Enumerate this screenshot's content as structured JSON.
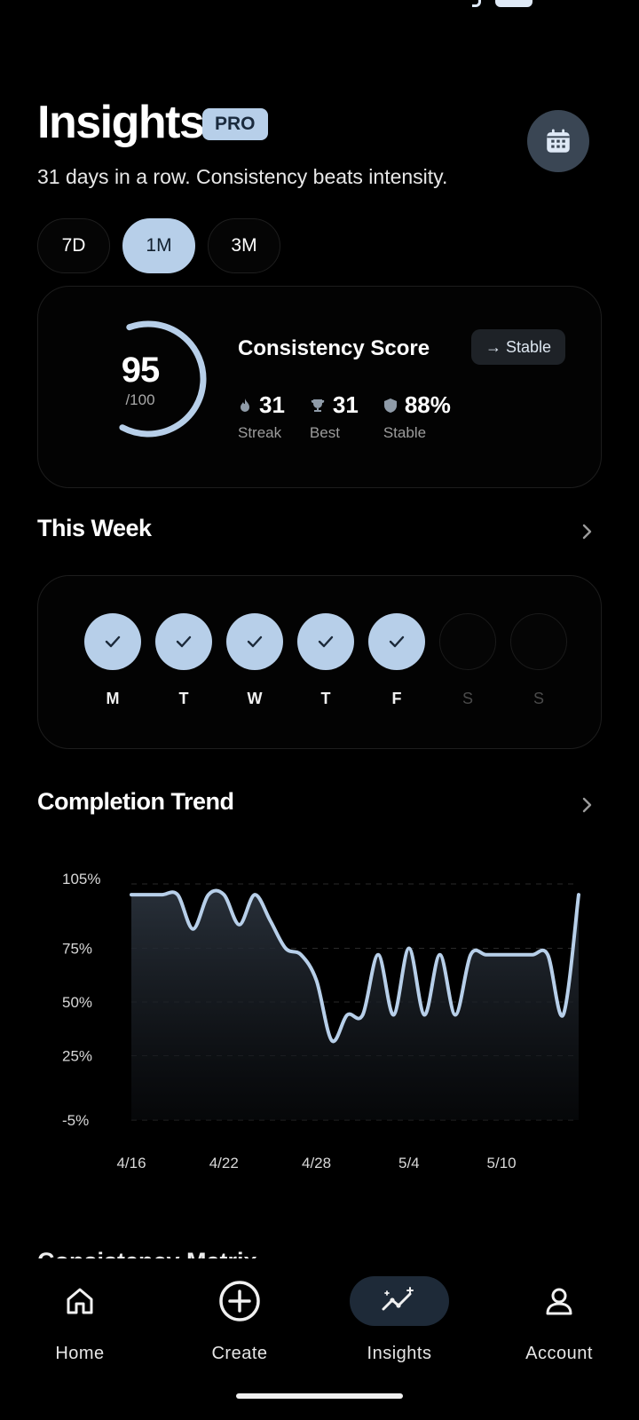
{
  "header": {
    "title": "Insights",
    "badge": "PRO",
    "subtitle": "31 days in a row. Consistency beats intensity.",
    "calendar_icon": "calendar-icon"
  },
  "range_tabs": [
    {
      "label": "7D",
      "active": false
    },
    {
      "label": "1M",
      "active": true
    },
    {
      "label": "3M",
      "active": false
    }
  ],
  "score": {
    "value": "95",
    "max": "/100",
    "fraction": 0.95,
    "title": "Consistency Score",
    "status": "→ Stable",
    "stats": [
      {
        "icon": "flame-icon",
        "value": "31",
        "label": "Streak"
      },
      {
        "icon": "trophy-icon",
        "value": "31",
        "label": "Best"
      },
      {
        "icon": "shield-icon",
        "value": "88%",
        "label": "Stable"
      }
    ]
  },
  "week": {
    "title": "This Week",
    "days": [
      {
        "label": "M",
        "done": true
      },
      {
        "label": "T",
        "done": true
      },
      {
        "label": "W",
        "done": true
      },
      {
        "label": "T",
        "done": true
      },
      {
        "label": "F",
        "done": true
      },
      {
        "label": "S",
        "done": false
      },
      {
        "label": "S",
        "done": false
      }
    ]
  },
  "trend": {
    "title": "Completion Trend"
  },
  "chart_data": {
    "type": "area",
    "title": "Completion Trend",
    "xlabel": "",
    "ylabel": "",
    "y_tick_labels": [
      "105%",
      "75%",
      "50%",
      "25%",
      "-5%"
    ],
    "x_tick_labels": [
      "4/16",
      "4/22",
      "4/28",
      "5/4",
      "5/10"
    ],
    "ylim": [
      -5,
      105
    ],
    "grid": true,
    "line_color": "#b7cfe9",
    "series": [
      {
        "x": [
          "4/16",
          "4/17",
          "4/18",
          "4/19",
          "4/20",
          "4/21",
          "4/22",
          "4/23",
          "4/24",
          "4/25",
          "4/26",
          "4/27",
          "4/28",
          "4/29",
          "4/30",
          "5/1",
          "5/2",
          "5/3",
          "5/4",
          "5/5",
          "5/6",
          "5/7",
          "5/8",
          "5/9",
          "5/10",
          "5/11",
          "5/12",
          "5/13",
          "5/14",
          "5/15"
        ],
        "values": [
          100,
          100,
          100,
          100,
          84,
          100,
          100,
          86,
          100,
          88,
          75,
          72,
          60,
          32,
          44,
          44,
          72,
          44,
          75,
          44,
          72,
          44,
          72,
          72,
          72,
          72,
          72,
          72,
          44,
          100
        ]
      }
    ]
  },
  "matrix": {
    "title": "Consistency Matrix"
  },
  "nav": [
    {
      "label": "Home",
      "icon": "home-icon",
      "active": false
    },
    {
      "label": "Create",
      "icon": "plus-circle-icon",
      "active": false
    },
    {
      "label": "Insights",
      "icon": "sparkline-icon",
      "active": true
    },
    {
      "label": "Account",
      "icon": "user-icon",
      "active": false
    }
  ],
  "colors": {
    "accent": "#b7cfe9",
    "background": "#000000",
    "card_border": "#1d1d1d"
  }
}
